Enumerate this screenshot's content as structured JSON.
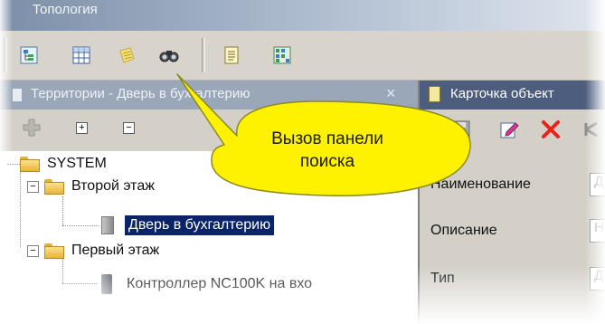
{
  "window": {
    "title": "Топология"
  },
  "toolbar": {
    "buttons": [
      {
        "icon": "tree-view-icon"
      },
      {
        "icon": "grid-icon"
      },
      {
        "icon": "notes-icon"
      },
      {
        "icon": "binoculars-icon"
      },
      {
        "icon": "document-icon"
      },
      {
        "icon": "map-icon"
      }
    ]
  },
  "left_panel": {
    "header": "Территории - Дверь в бухгалтерию",
    "close_glyph": "×",
    "expand_glyph": "+",
    "collapse_glyph": "−",
    "tree": [
      {
        "label": "SYSTEM",
        "expander": ""
      },
      {
        "label": "Второй этаж",
        "expander": "−"
      },
      {
        "label": "Дверь в бухгалтерию",
        "selected": true
      },
      {
        "label": "Первый этаж",
        "expander": "−"
      },
      {
        "label": "Контроллер NC100K на вхо"
      }
    ]
  },
  "right_panel": {
    "header": "Карточка объект",
    "fields": [
      {
        "label": "Наименование",
        "value": "Д"
      },
      {
        "label": "Описание",
        "value": "Н"
      },
      {
        "label": "Тип",
        "value": "Д"
      }
    ]
  },
  "callout": {
    "line1": "Вызов панели",
    "line2": "поиска"
  },
  "colors": {
    "selection": "#0a246a",
    "callout_fill": "#fff200",
    "panel_header_active": "#4c5d7d",
    "panel_header_inactive": "#99a7b8",
    "delete_red": "#e8231b"
  }
}
